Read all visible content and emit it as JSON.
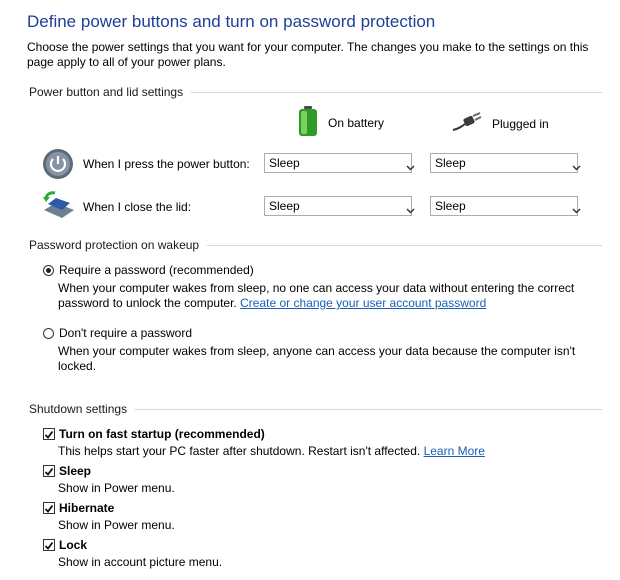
{
  "page": {
    "title": "Define power buttons and turn on password protection",
    "intro": "Choose the power settings that you want for your computer. The changes you make to the settings on this page apply to all of your power plans."
  },
  "power_section": {
    "heading": "Power button and lid settings",
    "col_battery": "On battery",
    "col_plugged": "Plugged in",
    "rows": [
      {
        "label": "When I press the power button:",
        "battery": "Sleep",
        "plugged": "Sleep"
      },
      {
        "label": "When I close the lid:",
        "battery": "Sleep",
        "plugged": "Sleep"
      }
    ]
  },
  "password_section": {
    "heading": "Password protection on wakeup",
    "opt_require": {
      "label": "Require a password (recommended)",
      "desc": "When your computer wakes from sleep, no one can access your data without entering the correct password to unlock the computer.",
      "link": "Create or change your user account password",
      "selected": true
    },
    "opt_none": {
      "label": "Don't require a password",
      "desc": "When your computer wakes from sleep, anyone can access your data because the computer isn't locked.",
      "selected": false
    }
  },
  "shutdown_section": {
    "heading": "Shutdown settings",
    "fast_startup": {
      "label": "Turn on fast startup (recommended)",
      "desc": "This helps start your PC faster after shutdown. Restart isn't affected.",
      "link": "Learn More",
      "checked": true
    },
    "sleep": {
      "label": "Sleep",
      "desc": "Show in Power menu.",
      "checked": true
    },
    "hibernate": {
      "label": "Hibernate",
      "desc": "Show in Power menu.",
      "checked": true
    },
    "lock": {
      "label": "Lock",
      "desc": "Show in account picture menu.",
      "checked": true
    }
  },
  "colors": {
    "title": "#1e3f96",
    "link": "#1a5fb4",
    "battery_green": "#3aa832"
  }
}
